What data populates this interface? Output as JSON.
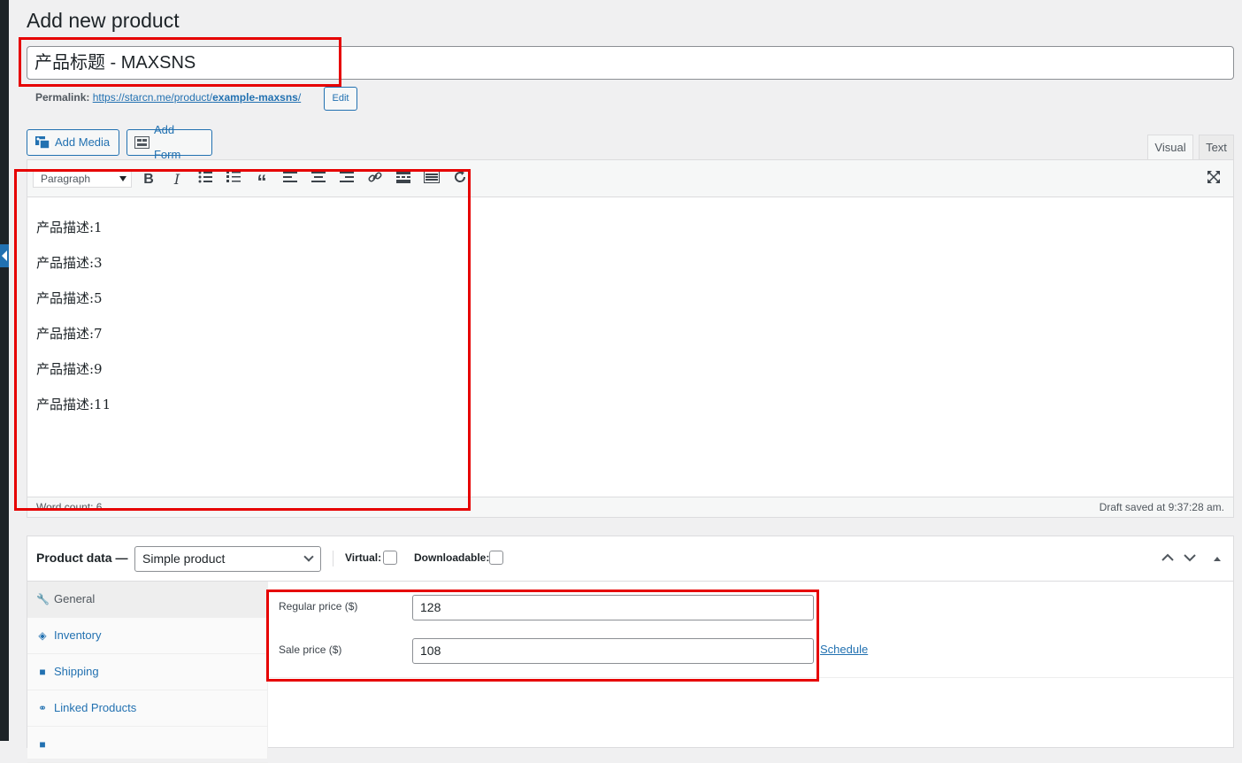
{
  "page": {
    "title": "Add new product"
  },
  "post_title": {
    "value": "产品标题 - MAXSNS"
  },
  "permalink": {
    "label": "Permalink:",
    "url_prefix": "https://starcn.me/product/",
    "slug": "example-maxsns",
    "suffix": "/",
    "edit_label": "Edit"
  },
  "media_buttons": {
    "add_media": "Add Media",
    "add_form": "Add Form"
  },
  "editor_tabs": {
    "visual": "Visual",
    "text": "Text"
  },
  "toolbar": {
    "format_select": "Paragraph",
    "buttons": [
      "bold",
      "italic",
      "bullet-list",
      "numbered-list",
      "blockquote",
      "align-left",
      "align-center",
      "align-right",
      "link",
      "read-more",
      "toolbar-toggle",
      "refresh"
    ]
  },
  "editor": {
    "paragraphs": [
      "产品描述:1",
      "产品描述:3",
      "产品描述:5",
      "产品描述:7",
      "产品描述:9",
      "产品描述:11"
    ],
    "word_count": "Word count: 6",
    "draft_status": "Draft saved at 9:37:28 am."
  },
  "product_data": {
    "label": "Product data —",
    "type_value": "Simple product",
    "virtual_label": "Virtual:",
    "downloadable_label": "Downloadable:",
    "tabs": [
      {
        "label": "General",
        "icon": "wrench-icon"
      },
      {
        "label": "Inventory",
        "icon": "tag-icon"
      },
      {
        "label": "Shipping",
        "icon": "truck-icon"
      },
      {
        "label": "Linked Products",
        "icon": "link-icon"
      }
    ],
    "regular_price_label": "Regular price ($)",
    "regular_price_value": "128",
    "sale_price_label": "Sale price ($)",
    "sale_price_value": "108",
    "schedule_label": "Schedule"
  },
  "colors": {
    "accent": "#2271b1",
    "highlight": "#e60000",
    "background": "#f0f0f1"
  }
}
